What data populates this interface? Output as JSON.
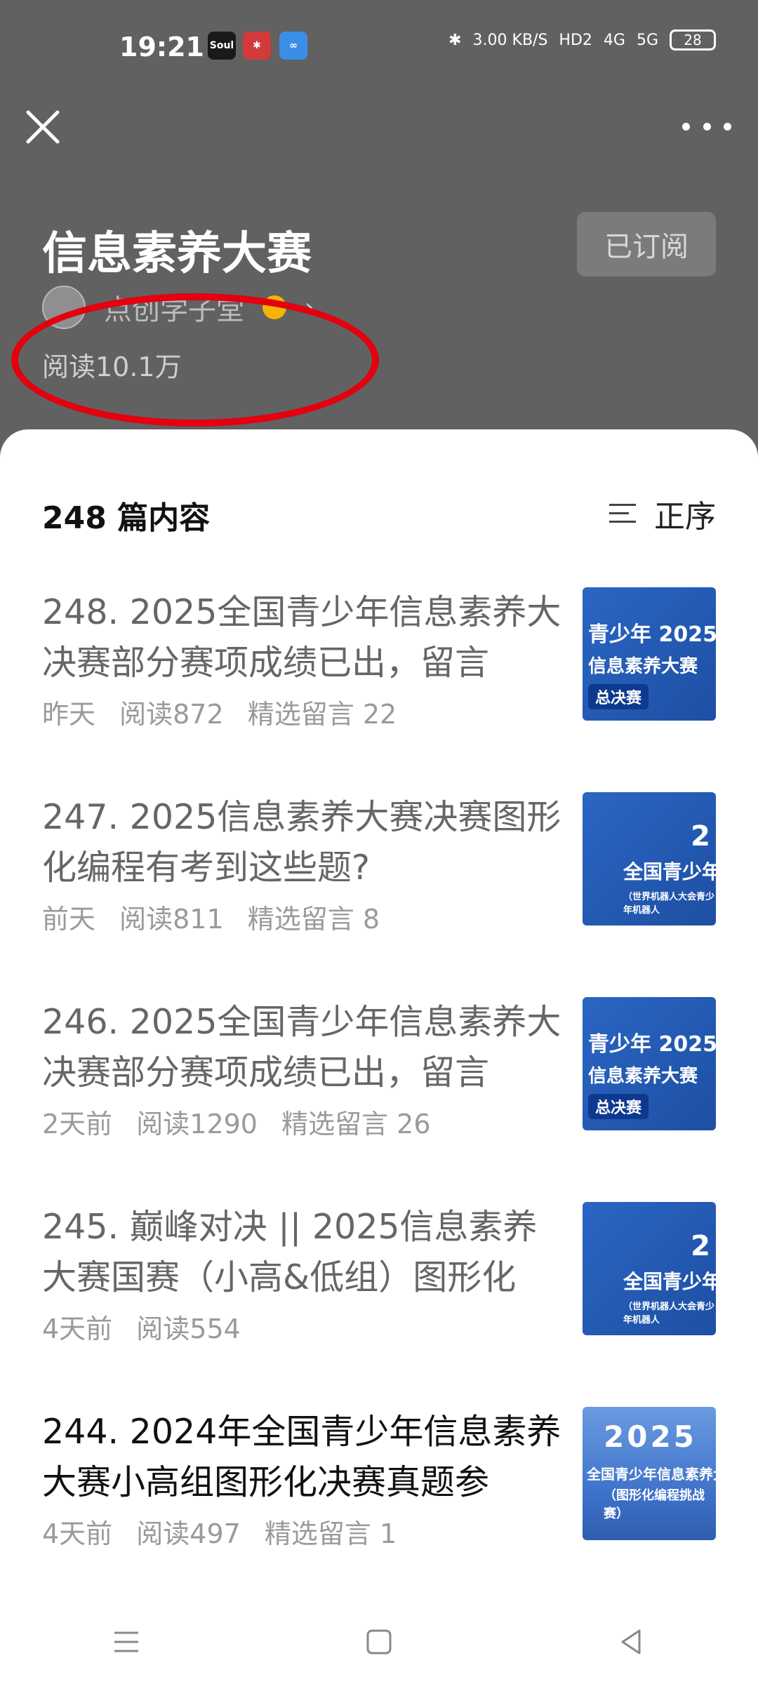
{
  "status_bar": {
    "time": "19:21",
    "app_icons": [
      "Soul",
      "✱",
      "∞"
    ],
    "net_speed": "3.00 KB/S",
    "hd": "HD2",
    "signal1": "4G",
    "signal2": "5G",
    "battery": "28"
  },
  "header": {
    "title": "信息素养大赛",
    "subscribe_label": "已订阅",
    "author_name": "点创学子堂",
    "reads": "阅读10.1万"
  },
  "list": {
    "count_label": "248 篇内容",
    "sort_label": "正序",
    "articles": [
      {
        "title": "248. 2025全国青少年信息素养大决赛部分赛项成绩已出，留言",
        "time": "昨天",
        "reads": "阅读872",
        "comments": "精选留言 22",
        "thumb": {
          "l1": "青少年 2025",
          "l2": "信息素养大赛",
          "l3": "总决赛"
        }
      },
      {
        "title": "247. 2025信息素养大赛决赛图形化编程有考到这些题?",
        "time": "前天",
        "reads": "阅读811",
        "comments": "精选留言 8",
        "thumb": {
          "l1": "2",
          "l2": "全国青少年",
          "l3": "（世界机器人大会青少年机器人"
        }
      },
      {
        "title": "246. 2025全国青少年信息素养大决赛部分赛项成绩已出，留言",
        "time": "2天前",
        "reads": "阅读1290",
        "comments": "精选留言 26",
        "thumb": {
          "l1": "青少年 2025",
          "l2": "信息素养大赛",
          "l3": "总决赛"
        }
      },
      {
        "title": "245. 巅峰对决 || 2025信息素养大赛国赛（小高&低组）图形化",
        "time": "4天前",
        "reads": "阅读554",
        "comments": "",
        "thumb": {
          "l1": "2",
          "l2": "全国青少年",
          "l3": "（世界机器人大会青少年机器人"
        }
      },
      {
        "title": "244. 2024年全国青少年信息素养大赛小高组图形化决赛真题参",
        "time": "4天前",
        "reads": "阅读497",
        "comments": "精选留言 1",
        "thumb": {
          "l1": "2025",
          "l2": "全国青少年信息素养大",
          "l3": "（图形化编程挑战赛）"
        }
      }
    ]
  },
  "nav": {
    "menu": "menu-icon",
    "home": "square-icon",
    "back": "triangle-back-icon"
  }
}
